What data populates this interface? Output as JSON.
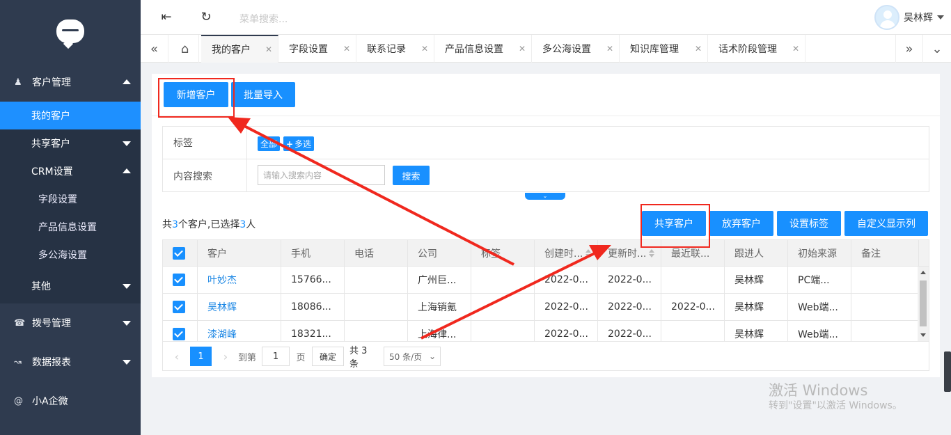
{
  "sidebar": {
    "groups": [
      {
        "label": "客户管理",
        "icon": "user-icon"
      },
      {
        "label": "拨号管理",
        "icon": "phone-icon"
      },
      {
        "label": "数据报表",
        "icon": "chart-icon"
      },
      {
        "label": "小A企微",
        "icon": "at-icon"
      }
    ],
    "items": {
      "my_customers": "我的客户",
      "shared_customers": "共享客户",
      "crm_settings": "CRM设置",
      "field_settings": "字段设置",
      "product_settings": "产品信息设置",
      "public_sea_settings": "多公海设置",
      "other": "其他"
    }
  },
  "topbar": {
    "menu_search_placeholder": "菜单搜索...",
    "user_name": "吴林辉"
  },
  "tabs": [
    "我的客户",
    "字段设置",
    "联系记录",
    "产品信息设置",
    "多公海设置",
    "知识库管理",
    "话术阶段管理"
  ],
  "toolbar": {
    "add_customer": "新增客户",
    "bulk_import": "批量导入"
  },
  "filter": {
    "tag_label": "标签",
    "tag_all": "全部",
    "tag_multi": "多选",
    "search_label": "内容搜索",
    "search_placeholder": "请输入搜索内容",
    "search_button": "搜索"
  },
  "summary": {
    "prefix": "共",
    "total": "3",
    "mid": "个客户,已选择",
    "selected": "3",
    "suffix": "人"
  },
  "actions": {
    "share": "共享客户",
    "abandon": "放弃客户",
    "set_tags": "设置标签",
    "custom_columns": "自定义显示列"
  },
  "table": {
    "headers": [
      "客户",
      "手机",
      "电话",
      "公司",
      "标签",
      "创建时...",
      "更新时...",
      "最近联...",
      "跟进人",
      "初始来源",
      "备注"
    ],
    "rows": [
      {
        "name": "叶妙杰",
        "mobile": "15766...",
        "phone": "",
        "company": "广州巨...",
        "tag": "",
        "created": "2022-0...",
        "updated": "2022-0...",
        "last_contact": "",
        "owner": "吴林辉",
        "source": "PC端...",
        "note": ""
      },
      {
        "name": "吴林辉",
        "mobile": "18086...",
        "phone": "",
        "company": "上海销氪",
        "tag": "",
        "created": "2022-0...",
        "updated": "2022-0...",
        "last_contact": "2022-0...",
        "owner": "吴林辉",
        "source": "Web端...",
        "note": ""
      },
      {
        "name": "漆湖峰",
        "mobile": "18321...",
        "phone": "",
        "company": "上海律...",
        "tag": "",
        "created": "2022-0...",
        "updated": "2022-0...",
        "last_contact": "",
        "owner": "吴林辉",
        "source": "Web端...",
        "note": ""
      }
    ]
  },
  "pager": {
    "current_page": "1",
    "goto_label": "到第",
    "page_input": "1",
    "page_unit": "页",
    "confirm": "确定",
    "total": "共 3 条",
    "page_size": "50 条/页"
  },
  "watermark": {
    "line1": "激活 Windows",
    "line2": "转到\"设置\"以激活 Windows。"
  },
  "colors": {
    "primary": "#1890ff",
    "sidebar": "#2f3b4f",
    "annotation_red": "#f0281e"
  }
}
